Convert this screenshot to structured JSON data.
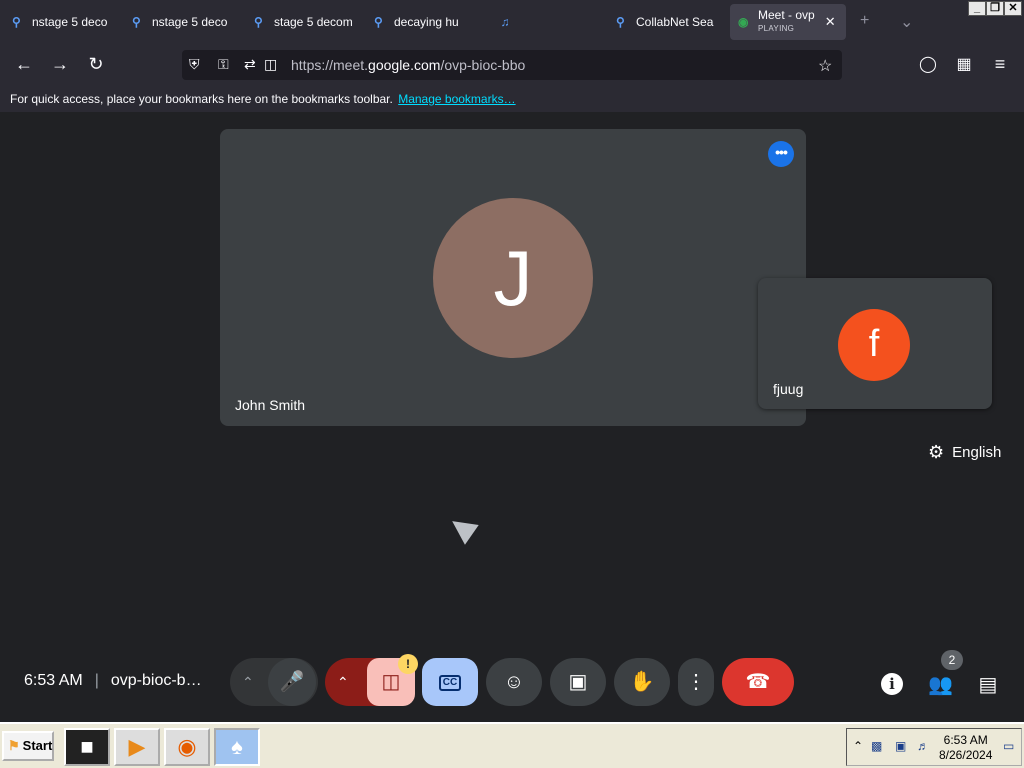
{
  "browser": {
    "tabs": [
      {
        "title": "nstage 5 deco",
        "icon": "search-icon"
      },
      {
        "title": "nstage 5 deco",
        "icon": "search-icon"
      },
      {
        "title": "stage 5 decom",
        "icon": "search-icon"
      },
      {
        "title": "decaying hu",
        "icon": "search-icon"
      },
      {
        "title": "CollabNet Sea",
        "icon": "search-icon"
      },
      {
        "title": "Meet - ovp",
        "subtitle": "PLAYING",
        "icon": "google-meet-icon",
        "active": true
      }
    ],
    "url": {
      "prefix": "https://meet.",
      "domain": "google.com",
      "path": "/ovp-bioc-bbo"
    },
    "bookmarks_bar": {
      "message": "For quick access, place your bookmarks here on the bookmarks toolbar.",
      "link": "Manage bookmarks…"
    }
  },
  "meeting": {
    "main_participant": {
      "name": "John Smith",
      "initial": "J",
      "avatar_color": "#8d6e63"
    },
    "self_participant": {
      "name": "fjuug",
      "initial": "f",
      "avatar_color": "#f4511e"
    },
    "caption_language": "English",
    "time": "6:53 AM",
    "meeting_code": "ovp-bioc-b…",
    "people_count": "2",
    "camera_warning": "!"
  },
  "taskbar": {
    "start_label": "Start",
    "apps": [
      "terminal-icon",
      "media-player-icon",
      "firefox-icon",
      "solitaire-icon"
    ],
    "clock_time": "6:53 AM",
    "clock_date": "8/26/2024"
  }
}
